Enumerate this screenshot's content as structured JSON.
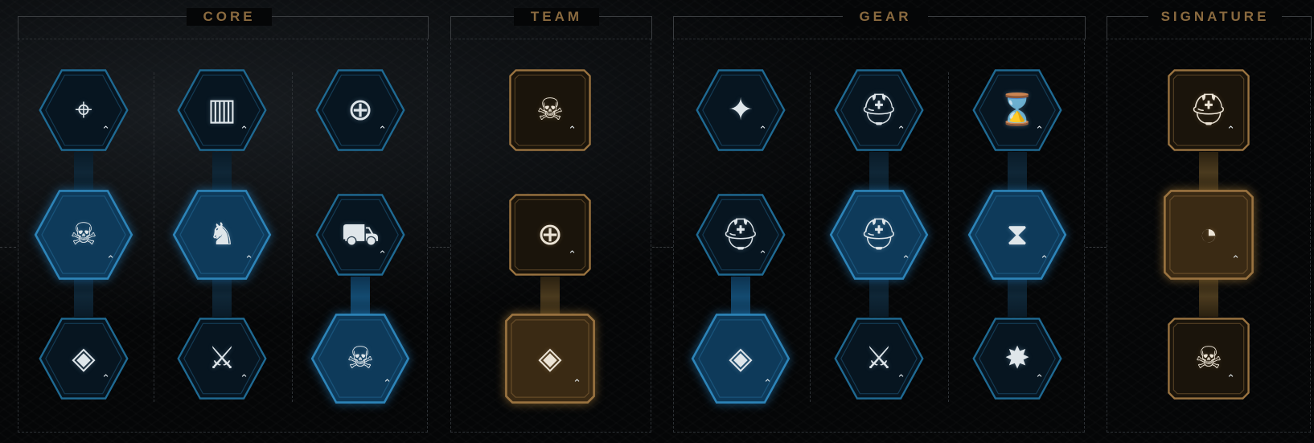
{
  "sections": {
    "core": {
      "title": "CORE"
    },
    "team": {
      "title": "TEAM"
    },
    "gear": {
      "title": "GEAR"
    },
    "signature": {
      "title": "SIGNATURE"
    }
  },
  "colors": {
    "hex_border": "#1f6a93",
    "hex_fill": "#071520",
    "hex_active_fill": "#0e3a5a",
    "hex_active_border": "#2d84b8",
    "gold_border": "#9a7340",
    "gold_fill": "#1a140b",
    "gold_active_fill": "#3a2a14",
    "title": "#8a6a3f"
  },
  "perks": [
    {
      "section": "core",
      "column": 1,
      "row": 1,
      "icon": "card-target-icon",
      "glyph": "⌖",
      "active": false
    },
    {
      "section": "core",
      "column": 1,
      "row": 2,
      "icon": "skull-sword-icon",
      "glyph": "☠",
      "active": true
    },
    {
      "section": "core",
      "column": 1,
      "row": 3,
      "icon": "diamond-chain-icon",
      "glyph": "◈",
      "active": false
    },
    {
      "section": "core",
      "column": 2,
      "row": 1,
      "icon": "ammo-rack-icon",
      "glyph": "▥",
      "active": false
    },
    {
      "section": "core",
      "column": 2,
      "row": 2,
      "icon": "beast-charge-icon",
      "glyph": "♞",
      "active": true
    },
    {
      "section": "core",
      "column": 2,
      "row": 3,
      "icon": "blade-upgrade-icon",
      "glyph": "⚔",
      "active": false
    },
    {
      "section": "core",
      "column": 3,
      "row": 1,
      "icon": "crosshair-icon",
      "glyph": "⊕",
      "active": false
    },
    {
      "section": "core",
      "column": 3,
      "row": 2,
      "icon": "heavy-weapon-icon",
      "glyph": "⛟",
      "active": false
    },
    {
      "section": "core",
      "column": 3,
      "row": 3,
      "icon": "skulls-rifle-icon",
      "glyph": "☠",
      "active": true
    },
    {
      "section": "team",
      "column": 1,
      "row": 1,
      "icon": "skull-emblem-icon",
      "glyph": "☠",
      "active": false
    },
    {
      "section": "team",
      "column": 1,
      "row": 2,
      "icon": "target-arrows-icon",
      "glyph": "⊕",
      "active": false
    },
    {
      "section": "team",
      "column": 1,
      "row": 3,
      "icon": "diamond-skull-icon",
      "glyph": "◈",
      "active": true
    },
    {
      "section": "gear",
      "column": 1,
      "row": 1,
      "icon": "helmet-sparkle-icon",
      "glyph": "✦",
      "active": false
    },
    {
      "section": "gear",
      "column": 1,
      "row": 2,
      "icon": "helmet-stack-icon",
      "glyph": "⛑",
      "active": false
    },
    {
      "section": "gear",
      "column": 1,
      "row": 3,
      "icon": "diamond-skull-icon",
      "glyph": "◈",
      "active": true
    },
    {
      "section": "gear",
      "column": 2,
      "row": 1,
      "icon": "twin-helmets-icon",
      "glyph": "⛑",
      "active": false
    },
    {
      "section": "gear",
      "column": 2,
      "row": 2,
      "icon": "helmet-ammo-icon",
      "glyph": "⛑",
      "active": true
    },
    {
      "section": "gear",
      "column": 2,
      "row": 3,
      "icon": "helmet-sword-icon",
      "glyph": "⚔",
      "active": false
    },
    {
      "section": "gear",
      "column": 3,
      "row": 1,
      "icon": "shield-hourglass-icon",
      "glyph": "⌛",
      "active": false
    },
    {
      "section": "gear",
      "column": 3,
      "row": 2,
      "icon": "helmet-hourglass-icon",
      "glyph": "⧗",
      "active": true
    },
    {
      "section": "gear",
      "column": 3,
      "row": 3,
      "icon": "helmet-burst-icon",
      "glyph": "✸",
      "active": false
    },
    {
      "section": "signature",
      "column": 1,
      "row": 1,
      "icon": "helmet-dash-icon",
      "glyph": "⛑",
      "active": false
    },
    {
      "section": "signature",
      "column": 1,
      "row": 2,
      "icon": "helmet-swirl-icon",
      "glyph": "◔",
      "active": true
    },
    {
      "section": "signature",
      "column": 1,
      "row": 3,
      "icon": "skull-fortress-icon",
      "glyph": "☠",
      "active": false
    }
  ]
}
